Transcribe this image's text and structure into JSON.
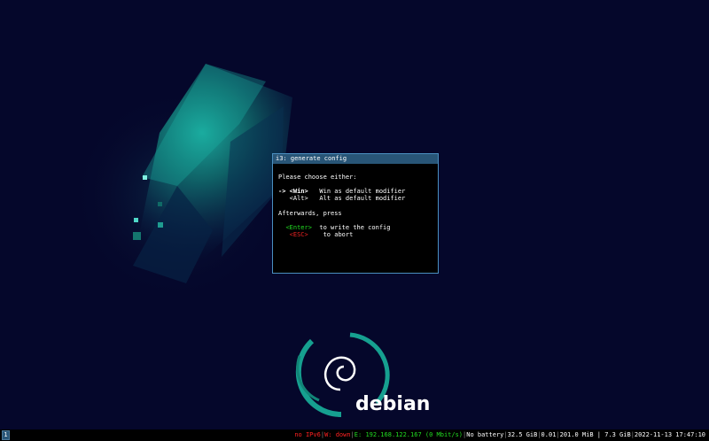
{
  "wallpaper": {
    "logo_text": "debian",
    "logo_color": "#ffffff",
    "swirl_color": "#1a9a8e"
  },
  "dialog": {
    "title": "i3: generate config",
    "prompt": "Please choose either:",
    "options": [
      {
        "arrow": "-> ",
        "key": "<Win>",
        "desc": "Win as default modifier",
        "selected": true
      },
      {
        "arrow": "   ",
        "key": "<Alt>",
        "desc": "Alt as default modifier",
        "selected": false
      }
    ],
    "afterwards": "Afterwards, press",
    "actions": [
      {
        "key": "<Enter>",
        "desc": "to write the config",
        "color": "#22dd22"
      },
      {
        "key": "<ESC>",
        "desc": "to abort",
        "color": "#ee2222"
      }
    ]
  },
  "statusbar": {
    "workspace": "1",
    "items": [
      {
        "text": "no IPv6",
        "color": "red"
      },
      {
        "text": "W: down",
        "color": "red"
      },
      {
        "text": "E: 192.168.122.167 (0 Mbit/s)",
        "color": "green"
      },
      {
        "text": "No battery",
        "color": "white"
      },
      {
        "text": "32.5 GiB",
        "color": "white"
      },
      {
        "text": "0.01",
        "color": "white"
      },
      {
        "text": "201.0 MiB | 7.3 GiB",
        "color": "white"
      },
      {
        "text": "2022-11-13 17:47:10",
        "color": "white"
      }
    ]
  }
}
